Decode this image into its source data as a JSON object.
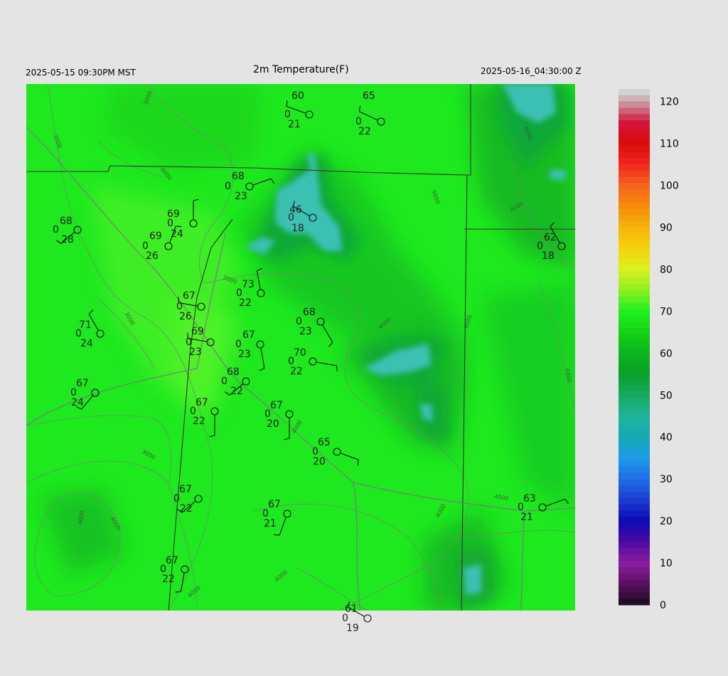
{
  "header": {
    "local_time": "2025-05-15 09:30PM MST",
    "title": "2m Temperature(F)",
    "valid_time": "2025-05-16_04:30:00 Z"
  },
  "legend": {
    "labels": [
      "120",
      "110",
      "100",
      "90",
      "80",
      "70",
      "60",
      "50",
      "40",
      "30",
      "20",
      "10",
      "0"
    ],
    "values": [
      120,
      110,
      100,
      90,
      80,
      70,
      60,
      50,
      40,
      30,
      20,
      10,
      0
    ]
  },
  "contour_labels": [
    "3000",
    "4000",
    "5000"
  ],
  "stations": [
    {
      "id": "s1",
      "temp": "60",
      "dew": "21",
      "zero": "0"
    },
    {
      "id": "s2",
      "temp": "65",
      "dew": "22",
      "zero": "0"
    },
    {
      "id": "s3",
      "temp": "68",
      "dew": "23",
      "zero": "0"
    },
    {
      "id": "s4",
      "temp": "46",
      "dew": "18",
      "zero": "0"
    },
    {
      "id": "s5",
      "temp": "68",
      "dew": "28",
      "zero": "0"
    },
    {
      "id": "s6",
      "temp": "69",
      "dew": "24",
      "zero": "0"
    },
    {
      "id": "s7",
      "temp": "69",
      "dew": "26",
      "zero": "0"
    },
    {
      "id": "s8",
      "temp": "62",
      "dew": "18",
      "zero": "0"
    },
    {
      "id": "s9",
      "temp": "73",
      "dew": "22",
      "zero": "0"
    },
    {
      "id": "s10",
      "temp": "67",
      "dew": "26",
      "zero": "0"
    },
    {
      "id": "s11",
      "temp": "68",
      "dew": "23",
      "zero": "0"
    },
    {
      "id": "s12",
      "temp": "71",
      "dew": "24",
      "zero": "0"
    },
    {
      "id": "s13",
      "temp": "69",
      "dew": "23",
      "zero": "0"
    },
    {
      "id": "s14",
      "temp": "67",
      "dew": "23",
      "zero": "0"
    },
    {
      "id": "s15",
      "temp": "70",
      "dew": "22",
      "zero": "0"
    },
    {
      "id": "s16",
      "temp": "68",
      "dew": "22",
      "zero": "0"
    },
    {
      "id": "s17",
      "temp": "67",
      "dew": "24",
      "zero": "0"
    },
    {
      "id": "s18",
      "temp": "67",
      "dew": "22",
      "zero": "0"
    },
    {
      "id": "s19",
      "temp": "67",
      "dew": "20",
      "zero": "0"
    },
    {
      "id": "s20",
      "temp": "65",
      "dew": "20",
      "zero": "0"
    },
    {
      "id": "s21",
      "temp": "67",
      "dew": "22",
      "zero": "0"
    },
    {
      "id": "s22",
      "temp": "67",
      "dew": "21",
      "zero": "0"
    },
    {
      "id": "s23",
      "temp": "63",
      "dew": "21",
      "zero": "0"
    },
    {
      "id": "s24",
      "temp": "67",
      "dew": "22",
      "zero": "0"
    },
    {
      "id": "s25",
      "temp": "61",
      "dew": "19",
      "zero": "0"
    }
  ],
  "colors": {
    "background": "#e4e4e4",
    "map_base": "#1ee81e",
    "map_dark": "#0faa30",
    "cold_cyan": "#3cc0b4",
    "boundary": "#333333",
    "contour": "#6b8c6b"
  }
}
